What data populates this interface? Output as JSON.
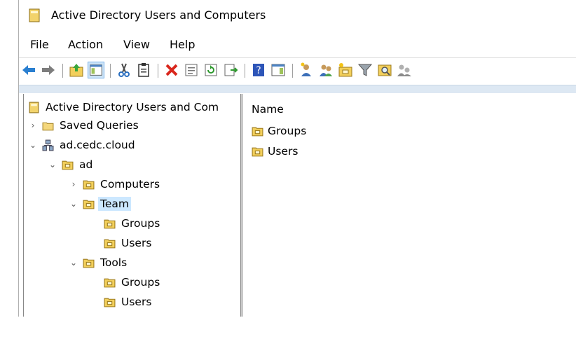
{
  "window": {
    "title": "Active Directory Users and Computers"
  },
  "menu": [
    "File",
    "Action",
    "View",
    "Help"
  ],
  "toolbar": [
    "back-arrow-icon",
    "forward-arrow-icon",
    "up-folder-icon",
    "show-console-tree-icon",
    "cut-icon",
    "clipboard-icon",
    "delete-icon",
    "properties-icon",
    "refresh-icon",
    "export-list-icon",
    "help-icon",
    "action-pane-icon",
    "new-user-icon",
    "new-group-icon",
    "new-ou-icon",
    "filter-icon",
    "find-icon",
    "delegate-icon"
  ],
  "tree": [
    {
      "label": "Active Directory Users and Com",
      "icon": "console-root-icon",
      "exp": ""
    },
    {
      "label": "Saved Queries",
      "icon": "folder-icon",
      "exp": ">"
    },
    {
      "label": "ad.cedc.cloud",
      "icon": "domain-icon",
      "exp": "v"
    },
    {
      "label": "ad",
      "icon": "ou-icon",
      "exp": "v"
    },
    {
      "label": "Computers",
      "icon": "ou-icon",
      "exp": ">"
    },
    {
      "label": "Team",
      "icon": "ou-icon",
      "exp": "v",
      "selected": true
    },
    {
      "label": "Groups",
      "icon": "ou-icon",
      "exp": ""
    },
    {
      "label": "Users",
      "icon": "ou-icon",
      "exp": ""
    },
    {
      "label": "Tools",
      "icon": "ou-icon",
      "exp": "v"
    },
    {
      "label": "Groups",
      "icon": "ou-icon",
      "exp": ""
    },
    {
      "label": "Users",
      "icon": "ou-icon",
      "exp": ""
    }
  ],
  "list": {
    "column": "Name",
    "items": [
      {
        "label": "Groups",
        "icon": "ou-icon"
      },
      {
        "label": "Users",
        "icon": "ou-icon"
      }
    ]
  }
}
